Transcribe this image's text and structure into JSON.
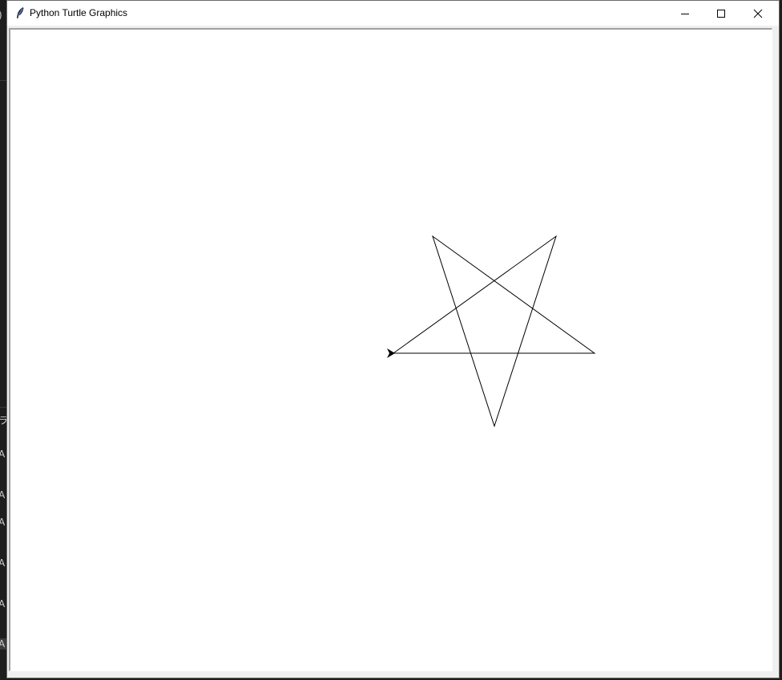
{
  "window": {
    "title": "Python Turtle Graphics",
    "icon": "feather-icon",
    "controls": {
      "minimize": "minimize-icon",
      "maximize": "maximize-icon",
      "close": "close-icon"
    }
  },
  "canvas": {
    "background_color": "#ffffff",
    "pen_color": "#000000",
    "drawing": "five-pointed-star",
    "turtle": {
      "shape": "arrow",
      "color": "#000000",
      "heading": "east"
    }
  },
  "background_app": {
    "fragments": [
      ")",
      "ラ",
      "A",
      "A",
      "A",
      "A",
      "A",
      "A"
    ]
  }
}
